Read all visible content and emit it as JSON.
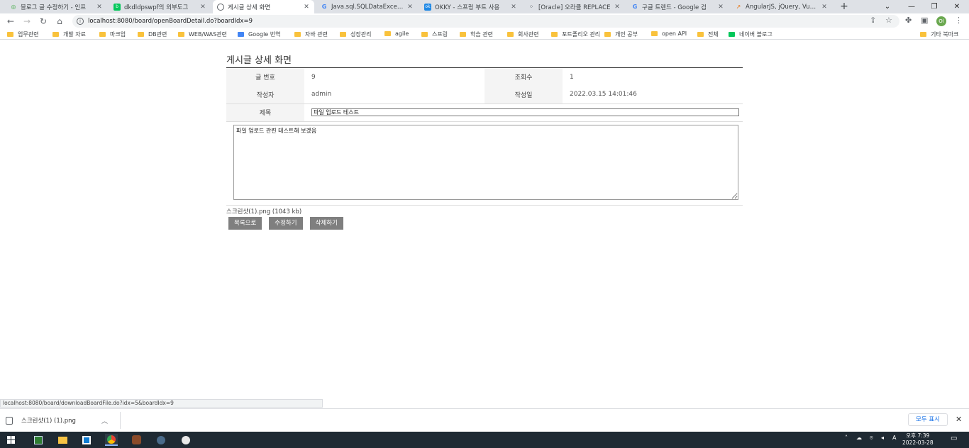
{
  "browser": {
    "tabs": [
      {
        "title": "블로그 글 수정하기 - 인프",
        "icon": "tistory-icon",
        "active": false
      },
      {
        "title": "dkdldpswpf의 외부도그",
        "icon": "naver-blog-icon",
        "active": false
      },
      {
        "title": "게시글 상세 화면",
        "icon": "globe-icon",
        "active": true
      },
      {
        "title": "Java.sql.SQLDataException:",
        "icon": "google-icon",
        "active": false
      },
      {
        "title": "OKKY - 스프링 부트 사용",
        "icon": "okky-icon",
        "active": false
      },
      {
        "title": "[Oracle] 오라클 REPLACE",
        "icon": "dot-grid-icon",
        "active": false
      },
      {
        "title": "구글 트렌드 - Google 검",
        "icon": "google-icon",
        "active": false
      },
      {
        "title": "AngularJS, jQuery, Vue.js",
        "icon": "trend-icon",
        "active": false
      }
    ],
    "url": "localhost:8080/board/openBoardDetail.do?boardIdx=9",
    "profile_initial": "Ol",
    "bookmarks": [
      "업무관련",
      "개발 자료",
      "마크업",
      "DB관련",
      "WEB/WAS관련",
      "Google 번역",
      "자바 관련",
      "성장관리",
      "agile",
      "스프링",
      "학습 관련",
      "회사관련",
      "포트폴리오 관리",
      "개인 공부",
      "open API",
      "전체",
      "네이버 블로그",
      "기타 북마크"
    ],
    "status_url": "localhost:8080/board/downloadBoardFile.do?idx=5&boardIdx=9"
  },
  "page": {
    "title": "게시글 상세 화면",
    "labels": {
      "post_no": "글 번호",
      "views": "조회수",
      "author": "작성자",
      "created": "작성일",
      "subject": "제목"
    },
    "values": {
      "post_no": "9",
      "views": "1",
      "author": "admin",
      "created": "2022.03.15 14:01:46"
    },
    "subject_value": "파일 업로드 테스트",
    "content_value": "파일 업로드 관련 테스트해 보겠음",
    "file": "스크린샷(1).png (1043 kb)",
    "buttons": {
      "list": "목록으로",
      "edit": "수정하기",
      "delete": "삭제하기"
    }
  },
  "downloads": {
    "item": "스크린샷(1) (1).png",
    "show_all": "모두 표시"
  },
  "taskbar": {
    "time": "오후 7:39",
    "date": "2022-03-28"
  }
}
